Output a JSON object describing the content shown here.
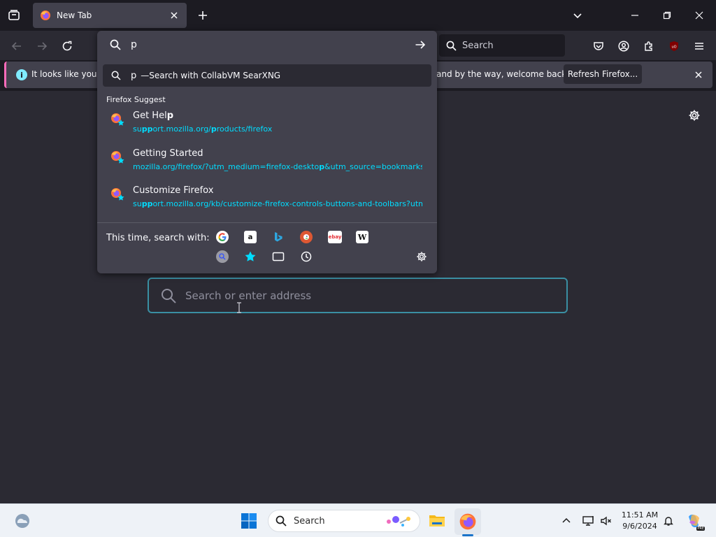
{
  "tabs": [
    {
      "label": "New Tab",
      "active": true
    }
  ],
  "toolbar": {
    "search_placeholder": "Search"
  },
  "notification": {
    "text_left": "It looks like you ha",
    "text_right": "and by the way, welcome back!",
    "refresh_label": "Refresh Firefox..."
  },
  "urlbar": {
    "value": "p",
    "search_row_query": "p",
    "search_row_sep": "— ",
    "search_row_label": "Search with CollabVM SearXNG",
    "suggest_heading": "Firefox Suggest",
    "suggestions": [
      {
        "title_pre": "Get Hel",
        "title_bold": "p",
        "url_pre": "su",
        "url_bold1": "pp",
        "url_mid": "ort.mozilla.org/",
        "url_bold2": "p",
        "url_post": "roducts/firefox"
      },
      {
        "title_pre": "Getting Started",
        "title_bold": "",
        "url_pre": "mozilla.org/firefox/?utm_medium=firefox-deskto",
        "url_bold1": "p",
        "url_mid": "&utm_source=bookmarks-t",
        "url_bold2": "",
        "url_post": ""
      },
      {
        "title_pre": "Customize Firefox",
        "title_bold": "",
        "url_pre": "su",
        "url_bold1": "pp",
        "url_mid": "ort.mozilla.org/kb/customize-firefox-controls-buttons-and-toolbars?utm",
        "url_bold2": "",
        "url_post": ""
      }
    ],
    "one_off_label": "This time, search with:",
    "engines": [
      "google-icon",
      "amazon-icon",
      "bing-icon",
      "duckduckgo-icon",
      "ebay-icon",
      "wikipedia-icon",
      "searxng-icon"
    ],
    "engine_glyphs": {
      "amazon": "a",
      "wikipedia": "W",
      "ebay": "ebay",
      "google": "G"
    }
  },
  "content": {
    "search_placeholder": "Search or enter address"
  },
  "taskbar": {
    "search_placeholder": "Search",
    "time": "11:51 AM",
    "date": "9/6/2024",
    "copilot_badge": "PRE"
  },
  "colors": {
    "accent": "#00ddff",
    "notif_border": "#ff6bba",
    "popup_bg": "#42414d",
    "content_bg": "#2b2a33"
  }
}
